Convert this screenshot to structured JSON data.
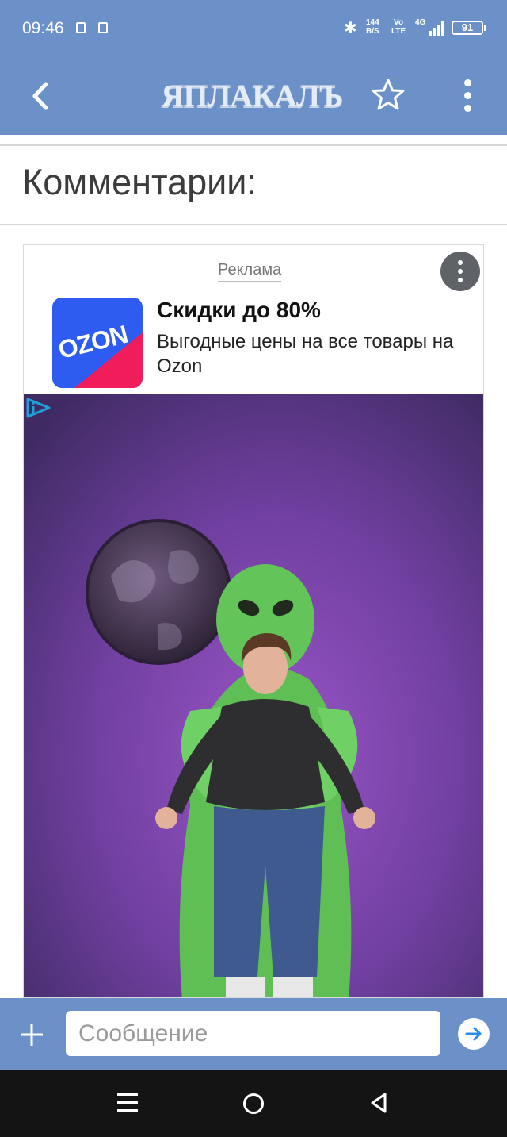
{
  "status": {
    "time": "09:46",
    "speed_value": "144",
    "speed_unit": "B/S",
    "volte_top": "Vo",
    "volte_bottom": "LTE",
    "network": "4G",
    "battery": "91"
  },
  "appbar": {
    "logo": "ЯПЛАКАЛЪ",
    "back_icon": "chevron-left-icon",
    "star_icon": "star-icon",
    "menu_icon": "more-vertical-icon"
  },
  "page": {
    "section_title": "Комментарии:"
  },
  "ad": {
    "label": "Реклама",
    "title": "Скидки до 80%",
    "description": "Выгодные цены на все товары на Ozon",
    "brand_logo_text": "OZON"
  },
  "composer": {
    "placeholder": "Сообщение"
  },
  "colors": {
    "app_blue": "#6c91c9",
    "ozon_blue": "#2e5bf0",
    "ozon_pink": "#f11d5b"
  }
}
